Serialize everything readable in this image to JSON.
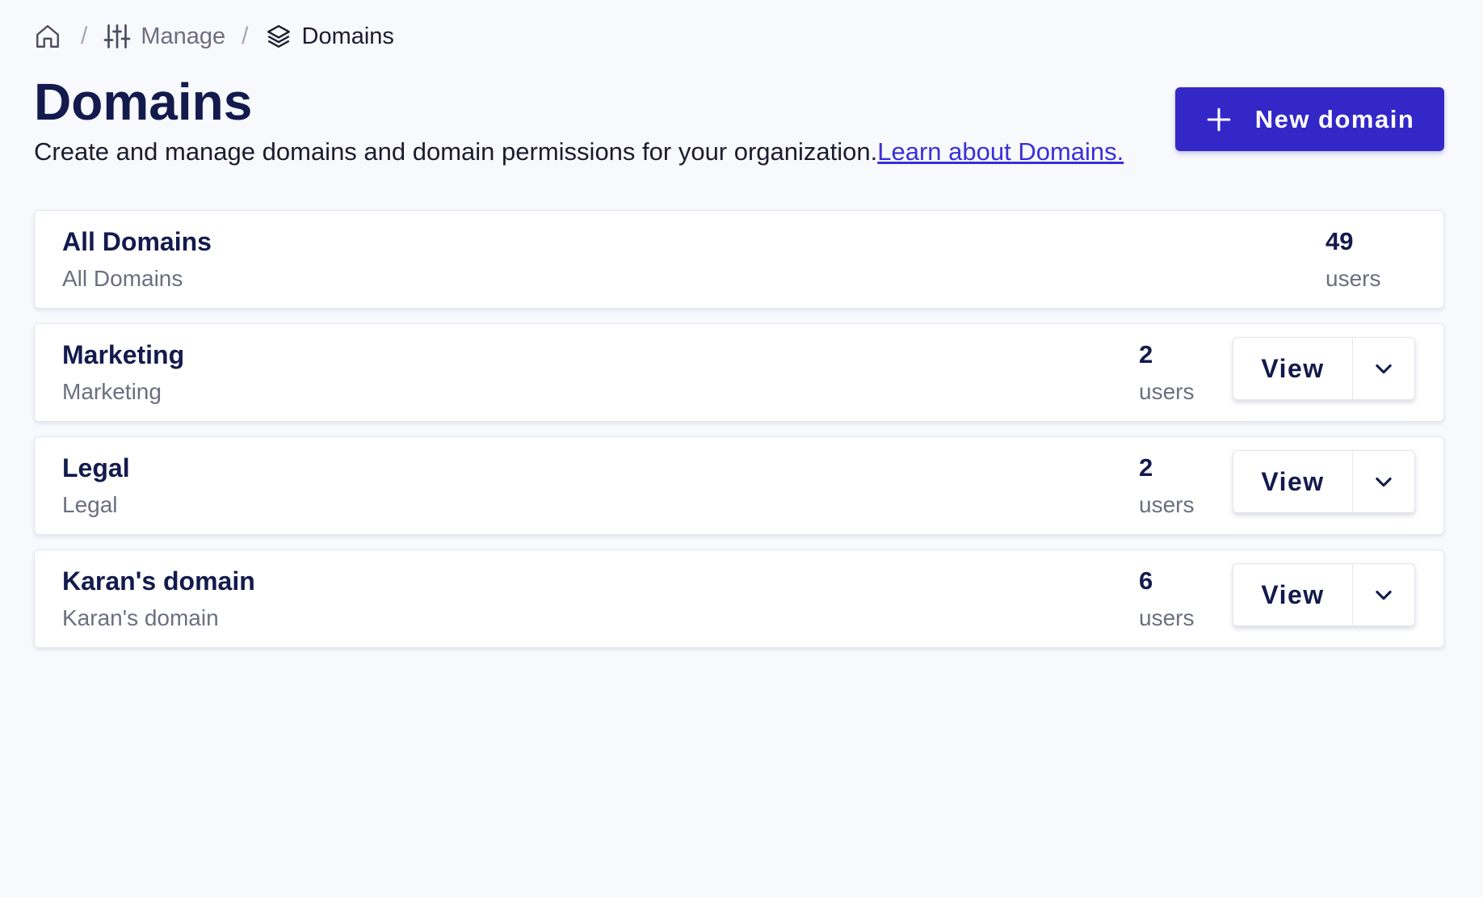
{
  "breadcrumb": {
    "home_icon": "home-icon",
    "manage_icon": "sliders-icon",
    "manage_label": "Manage",
    "current_icon": "layers-icon",
    "current_label": "Domains",
    "separator": "/"
  },
  "header": {
    "title": "Domains",
    "subtitle": "Create and manage domains and domain permissions for your organization.",
    "learn_link": "Learn about Domains.",
    "new_button_label": "New domain",
    "new_button_icon": "plus-icon"
  },
  "colors": {
    "primary": "#3327c8",
    "title": "#131a4d",
    "link": "#3a2fd8",
    "muted": "#6b6f80",
    "background": "#f8f9fd"
  },
  "domains": [
    {
      "name": "All Domains",
      "description": "All Domains",
      "count": "49",
      "count_label": "users",
      "has_actions": false
    },
    {
      "name": "Marketing",
      "description": "Marketing",
      "count": "2",
      "count_label": "users",
      "has_actions": true,
      "view_label": "View"
    },
    {
      "name": "Legal",
      "description": "Legal",
      "count": "2",
      "count_label": "users",
      "has_actions": true,
      "view_label": "View"
    },
    {
      "name": "Karan's domain",
      "description": "Karan's domain",
      "count": "6",
      "count_label": "users",
      "has_actions": true,
      "view_label": "View"
    }
  ]
}
